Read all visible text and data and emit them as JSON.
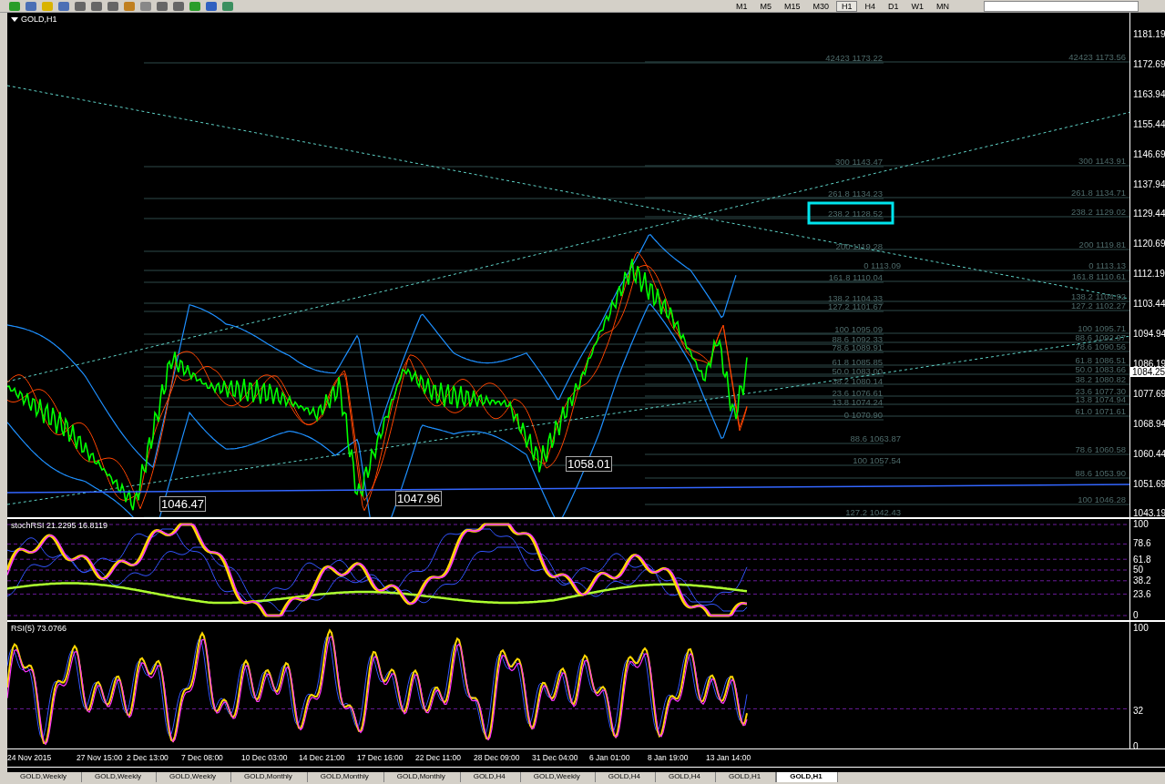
{
  "toolbar": {
    "timeframes": [
      {
        "label": "M1",
        "selected": false
      },
      {
        "label": "M5",
        "selected": false
      },
      {
        "label": "M15",
        "selected": false
      },
      {
        "label": "M30",
        "selected": false
      },
      {
        "label": "H1",
        "selected": true
      },
      {
        "label": "H4",
        "selected": false
      },
      {
        "label": "D1",
        "selected": false
      },
      {
        "label": "W1",
        "selected": false
      },
      {
        "label": "MN",
        "selected": false
      }
    ]
  },
  "chart": {
    "title": "GOLD,H1",
    "price_axis": [
      "1181.19",
      "1172.69",
      "1163.94",
      "1155.44",
      "1146.69",
      "1137.94",
      "1129.44",
      "1120.69",
      "1112.19",
      "1103.44",
      "1094.94",
      "1086.19",
      "1077.69",
      "1068.94",
      "1060.44",
      "1051.69",
      "1043.19"
    ],
    "current_price": "1084.25",
    "fib_left": [
      "42423 1173.22",
      "300 1143.47",
      "261.8 1134.23",
      "238.2 1128.52",
      "200 1119.28",
      "0 1113.09",
      "161.8 1110.04",
      "138.2 1104.33",
      "127.2 1101.67",
      "100 1095.09",
      "88.6 1092.33",
      "78.6 1089.91",
      "61.8 1085.85",
      "50.0 1083.00",
      "38.2 1080.14",
      "23.6 1076.61",
      "13.8 1074.24",
      "0 1070.90",
      "88.6 1063.87",
      "100 1057.54",
      "127.2 1042.43"
    ],
    "fib_right": [
      "42423 1173.56",
      "300 1143.91",
      "261.8 1134.71",
      "238.2 1129.02",
      "200 1119.81",
      "0 1113.13",
      "161.8 1110.61",
      "138.2 1104.92",
      "127.2 1102.27",
      "100 1095.71",
      "88.6 1092.97",
      "78.6 1090.56",
      "61.8 1086.51",
      "50.0 1083.66",
      "38.2 1080.82",
      "23.6 1077.30",
      "13.8 1074.94",
      "61.0 1071.61",
      "78.6 1060.58",
      "88.6 1053.90",
      "100 1046.28"
    ],
    "callouts": [
      "1046.47",
      "1047.96",
      "1058.01"
    ]
  },
  "stoch_rsi": {
    "title": "stochRSI 21.2295 16.8119",
    "axis": [
      "100",
      "78.6",
      "61.8",
      "50",
      "38.2",
      "23.6",
      "0"
    ]
  },
  "rsi": {
    "title": "RSI(5) 73.0766",
    "axis": [
      "100",
      "32",
      "0"
    ]
  },
  "time_axis": [
    "24 Nov 2015",
    "27 Nov 15:00",
    "2 Dec 13:00",
    "7 Dec 08:00",
    "10 Dec 03:00",
    "14 Dec 21:00",
    "17 Dec 16:00",
    "22 Dec 11:00",
    "28 Dec 09:00",
    "31 Dec 04:00",
    "6 Jan 01:00",
    "8 Jan 19:00",
    "13 Jan 14:00"
  ],
  "tabs": [
    {
      "label": "GOLD,Weekly",
      "selected": false
    },
    {
      "label": "GOLD,Weekly",
      "selected": false
    },
    {
      "label": "GOLD,Weekly",
      "selected": false
    },
    {
      "label": "GOLD,Monthly",
      "selected": false
    },
    {
      "label": "GOLD,Monthly",
      "selected": false
    },
    {
      "label": "GOLD,Monthly",
      "selected": false
    },
    {
      "label": "GOLD,H4",
      "selected": false
    },
    {
      "label": "GOLD,Weekly",
      "selected": false
    },
    {
      "label": "GOLD,H4",
      "selected": false
    },
    {
      "label": "GOLD,H4",
      "selected": false
    },
    {
      "label": "GOLD,H1",
      "selected": false
    },
    {
      "label": "GOLD,H1",
      "selected": true
    }
  ]
}
